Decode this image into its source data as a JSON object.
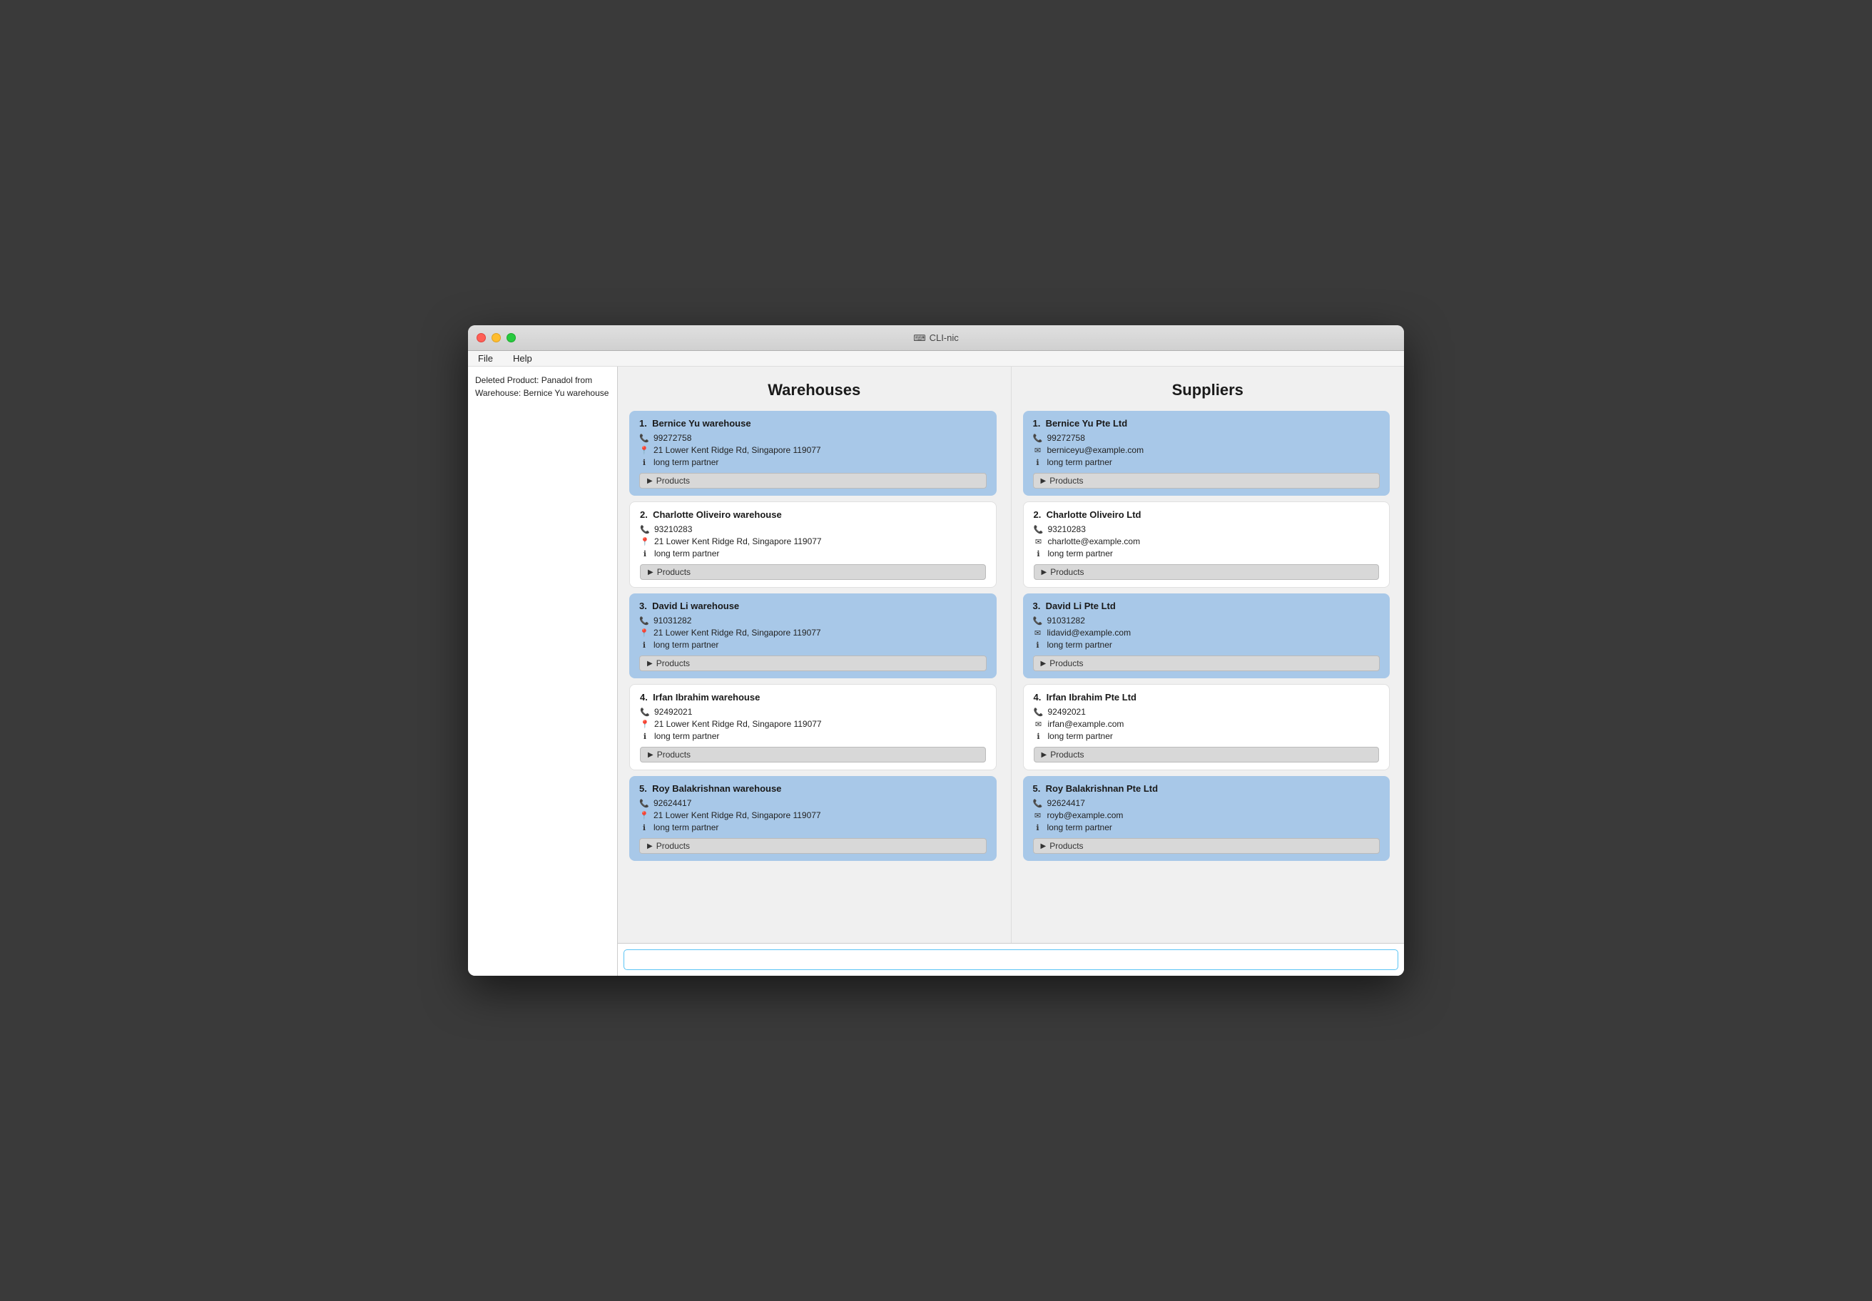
{
  "window": {
    "title": "CLI-nic"
  },
  "menu": {
    "items": [
      "File",
      "Help"
    ]
  },
  "sidebar": {
    "message": "Deleted Product: Panadol from Warehouse: Bernice Yu warehouse"
  },
  "warehouses": {
    "title": "Warehouses",
    "items": [
      {
        "number": "1.",
        "name": "Bernice Yu warehouse",
        "phone": "99272758",
        "address": "21 Lower Kent Ridge Rd, Singapore 119077",
        "info": "long term partner",
        "highlighted": true
      },
      {
        "number": "2.",
        "name": "Charlotte Oliveiro warehouse",
        "phone": "93210283",
        "address": "21 Lower Kent Ridge Rd, Singapore 119077",
        "info": "long term partner",
        "highlighted": false
      },
      {
        "number": "3.",
        "name": "David Li warehouse",
        "phone": "91031282",
        "address": "21 Lower Kent Ridge Rd, Singapore 119077",
        "info": "long term partner",
        "highlighted": true
      },
      {
        "number": "4.",
        "name": "Irfan Ibrahim warehouse",
        "phone": "92492021",
        "address": "21 Lower Kent Ridge Rd, Singapore 119077",
        "info": "long term partner",
        "highlighted": false
      },
      {
        "number": "5.",
        "name": "Roy Balakrishnan warehouse",
        "phone": "92624417",
        "address": "21 Lower Kent Ridge Rd, Singapore 119077",
        "info": "long term partner",
        "highlighted": true
      }
    ],
    "products_label": "Products"
  },
  "suppliers": {
    "title": "Suppliers",
    "items": [
      {
        "number": "1.",
        "name": "Bernice Yu Pte Ltd",
        "phone": "99272758",
        "email": "berniceyu@example.com",
        "info": "long term partner",
        "highlighted": true
      },
      {
        "number": "2.",
        "name": "Charlotte Oliveiro Ltd",
        "phone": "93210283",
        "email": "charlotte@example.com",
        "info": "long term partner",
        "highlighted": false
      },
      {
        "number": "3.",
        "name": "David Li Pte Ltd",
        "phone": "91031282",
        "email": "lidavid@example.com",
        "info": "long term partner",
        "highlighted": true
      },
      {
        "number": "4.",
        "name": "Irfan Ibrahim Pte Ltd",
        "phone": "92492021",
        "email": "irfan@example.com",
        "info": "long term partner",
        "highlighted": false
      },
      {
        "number": "5.",
        "name": "Roy Balakrishnan Pte Ltd",
        "phone": "92624417",
        "email": "royb@example.com",
        "info": "long term partner",
        "highlighted": true
      }
    ],
    "products_label": "Products"
  },
  "command_input": {
    "placeholder": "",
    "value": ""
  }
}
